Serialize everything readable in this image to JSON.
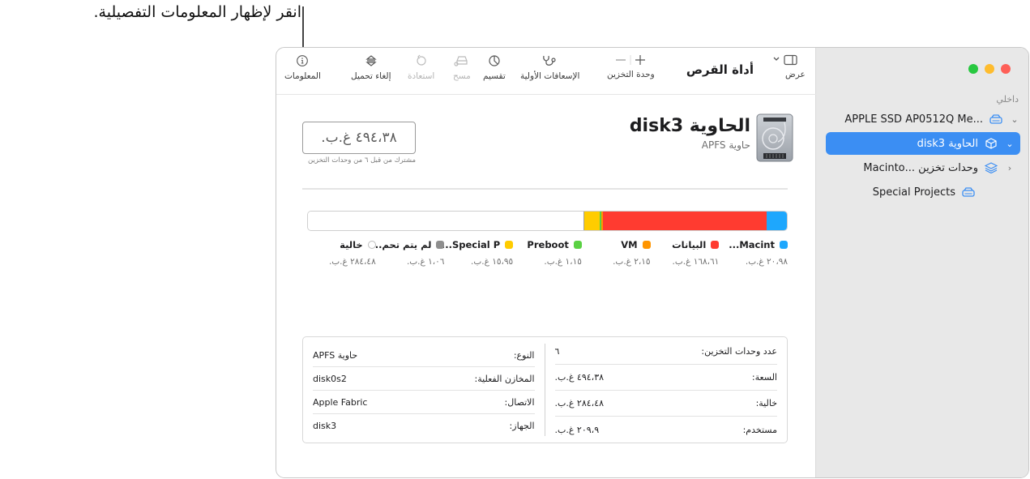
{
  "callout": {
    "text": "انقر لإظهار المعلومات التفصيلية."
  },
  "window": {
    "app_title": "أداة القرص",
    "toolbar": {
      "view": "عرض",
      "volume": "وحدة التخزين",
      "first_aid": "الإسعافات الأولية",
      "partition": "تقسيم",
      "erase": "مسح",
      "restore": "استعادة",
      "unmount": "إلغاء تحميل",
      "info": "المعلومات"
    },
    "sidebar": {
      "section": "داخلي",
      "items": [
        {
          "label": "APPLE SSD AP0512Q Me...",
          "icon": "internal-drive-icon",
          "expanded": true
        },
        {
          "label": "الحاوية disk3",
          "icon": "container-icon",
          "expanded": true,
          "selected": true
        },
        {
          "label": "وحدات تخزين ...Macinto",
          "icon": "volume-group-icon",
          "expanded": false
        },
        {
          "label": "Special Projects",
          "icon": "internal-drive-icon"
        }
      ]
    }
  },
  "volume": {
    "title": "الحاوية disk3",
    "subtitle": "حاوية APFS",
    "size": "٤٩٤،٣٨ غ.ب.",
    "shared_note": "مشترك من قبل ٦ من وحدات التخزين",
    "colors": {
      "macintosh": "#1ea7fd",
      "data": "#ff3b30",
      "vm": "#ff9500",
      "preboot": "#5ad143",
      "special": "#ffcc00",
      "other": "#8e8e8e",
      "free": "#ffffff"
    },
    "usage": [
      {
        "key": "macintosh",
        "name": "Macint...",
        "value": "٢٠،٩٨ غ.ب.",
        "gb": 20.98
      },
      {
        "key": "data",
        "name": "البيانات",
        "value": "١٦٨،٦١ غ.ب.",
        "gb": 168.61
      },
      {
        "key": "vm",
        "name": "VM",
        "value": "٢،١٥ غ.ب.",
        "gb": 2.15
      },
      {
        "key": "preboot",
        "name": "Preboot",
        "value": "١،١٥ غ.ب.",
        "gb": 1.15
      },
      {
        "key": "special",
        "name": "Special P...",
        "value": "١٥،٩٥ غ.ب.",
        "gb": 15.95
      },
      {
        "key": "other",
        "name": "لم يتم تحم...",
        "value": "١،٠٦ غ.ب.",
        "gb": 1.06
      },
      {
        "key": "free",
        "name": "خالية",
        "value": "٢٨٤،٤٨ غ.ب.",
        "gb": 284.48
      }
    ],
    "total_gb": 494.38,
    "info_right": [
      {
        "label": "عدد وحدات التخزين:",
        "value": "٦"
      },
      {
        "label": "السعة:",
        "value": "٤٩٤،٣٨ غ.ب."
      },
      {
        "label": "خالية:",
        "value": "٢٨٤،٤٨ غ.ب."
      },
      {
        "label": "مستخدم:",
        "value": "٢٠٩،٩ غ.ب."
      }
    ],
    "info_left": [
      {
        "label": "النوع:",
        "value": "حاوية APFS"
      },
      {
        "label": "المخازن الفعلية:",
        "value": "disk0s2"
      },
      {
        "label": "الاتصال:",
        "value": "Apple Fabric"
      },
      {
        "label": "الجهاز:",
        "value": "disk3"
      }
    ]
  }
}
